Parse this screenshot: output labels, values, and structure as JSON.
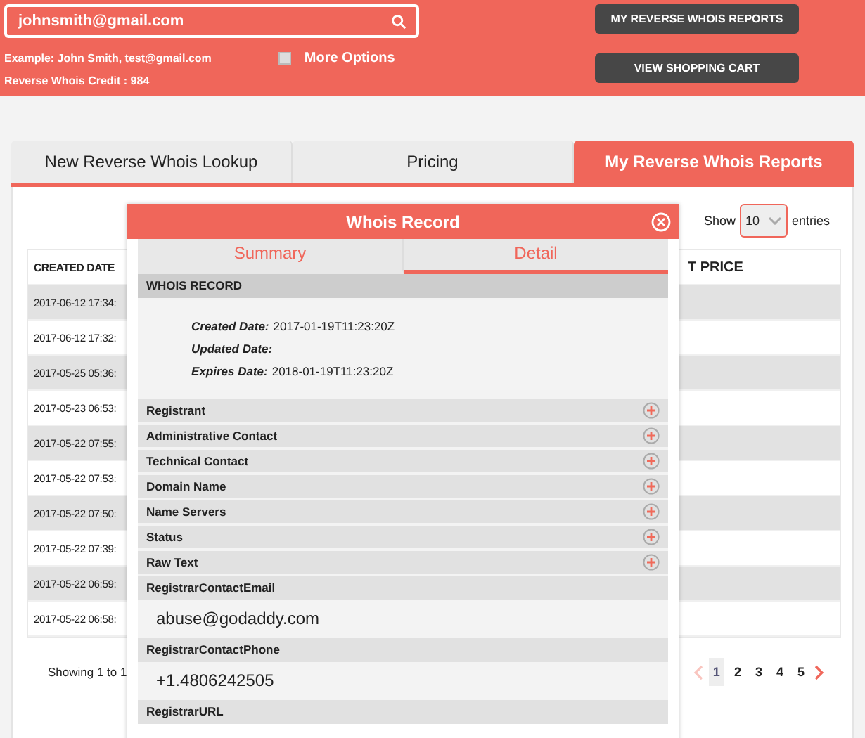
{
  "header": {
    "search": {
      "value": "johnsmith@gmail.com"
    },
    "example": "Example: John Smith, test@gmail.com",
    "more_options": {
      "label": "More Options",
      "checked": false
    },
    "credit": "Reverse Whois Credit : 984",
    "buttons": [
      "MY REVERSE WHOIS REPORTS",
      "VIEW SHOPPING CART"
    ]
  },
  "tabs": [
    {
      "label": "New Reverse Whois Lookup",
      "selected": false
    },
    {
      "label": "Pricing",
      "selected": false
    },
    {
      "label": "My Reverse Whois Reports",
      "selected": true
    }
  ],
  "entries": {
    "show": "Show",
    "value": "10",
    "suffix": "entries"
  },
  "table": {
    "columns": [
      "CREATED DATE",
      "T PRICE"
    ],
    "rows": [
      "2017-06-12 17:34:",
      "2017-06-12 17:32:",
      "2017-05-25 05:36:",
      "2017-05-23 06:53:",
      "2017-05-22 07:55:",
      "2017-05-22 07:53:",
      "2017-05-22 07:50:",
      "2017-05-22 07:39:",
      "2017-05-22 06:59:",
      "2017-05-22 06:58:"
    ]
  },
  "showing": "Showing 1 to 1",
  "pagination": {
    "prev_disabled": true,
    "pages": [
      {
        "label": "1",
        "selected": true
      },
      {
        "label": "2",
        "selected": false
      },
      {
        "label": "3",
        "selected": false
      },
      {
        "label": "4",
        "selected": false
      },
      {
        "label": "5",
        "selected": false
      }
    ],
    "next_disabled": false
  },
  "modal": {
    "title": "Whois Record",
    "tabs": [
      {
        "label": "Summary",
        "selected": false
      },
      {
        "label": "Detail",
        "selected": true
      }
    ],
    "section": "WHOIS RECORD",
    "dates": [
      {
        "label": "Created Date:",
        "value": "2017-01-19T11:23:20Z"
      },
      {
        "label": "Updated Date:"
      },
      {
        "label": "Expires Date:",
        "value": "2018-01-19T11:23:20Z"
      }
    ],
    "groups": [
      "Registrant",
      "Administrative Contact",
      "Technical Contact",
      "Domain Name",
      "Name Servers",
      "Status",
      "Raw Text"
    ],
    "fields": [
      {
        "label": "RegistrarContactEmail",
        "value": "abuse@godaddy.com"
      },
      {
        "label": "RegistrarContactPhone",
        "value": "+1.4806242505"
      },
      {
        "label": "RegistrarURL"
      }
    ]
  }
}
